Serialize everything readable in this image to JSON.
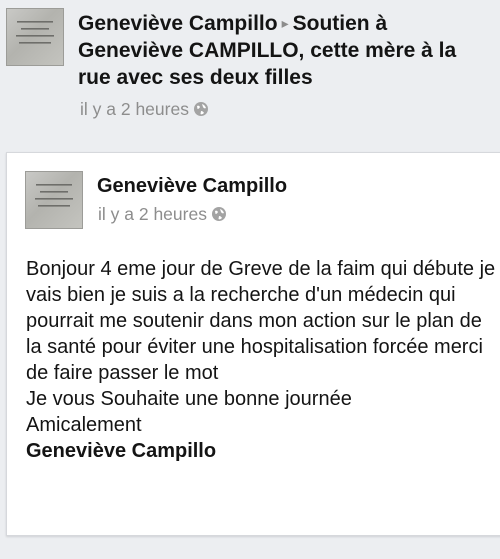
{
  "top_post": {
    "author": "Geneviève Campillo",
    "arrow": "▸",
    "target": "Soutien à Geneviève CAMPILLO, cette mère à la rue avec ses deux filles",
    "timestamp": "il y a 2 heures",
    "privacy_icon": "globe-icon"
  },
  "card": {
    "author": "Geneviève Campillo",
    "timestamp": "il y a 2 heures",
    "privacy_icon": "globe-icon",
    "message_lines": [
      "Bonjour 4 eme jour de Greve de la faim qui débute je vais bien je suis a la recherche d'un médecin qui pourrait me soutenir dans mon action sur le plan de la santé pour éviter une hospitalisation forcée merci de faire passer le mot",
      "Je vous Souhaite une bonne journée",
      "Amicalement"
    ],
    "signature": "Geneviève Campillo"
  },
  "colors": {
    "background": "#eceef1",
    "card": "#ffffff",
    "text": "#141414",
    "meta": "#8d8d8d"
  }
}
